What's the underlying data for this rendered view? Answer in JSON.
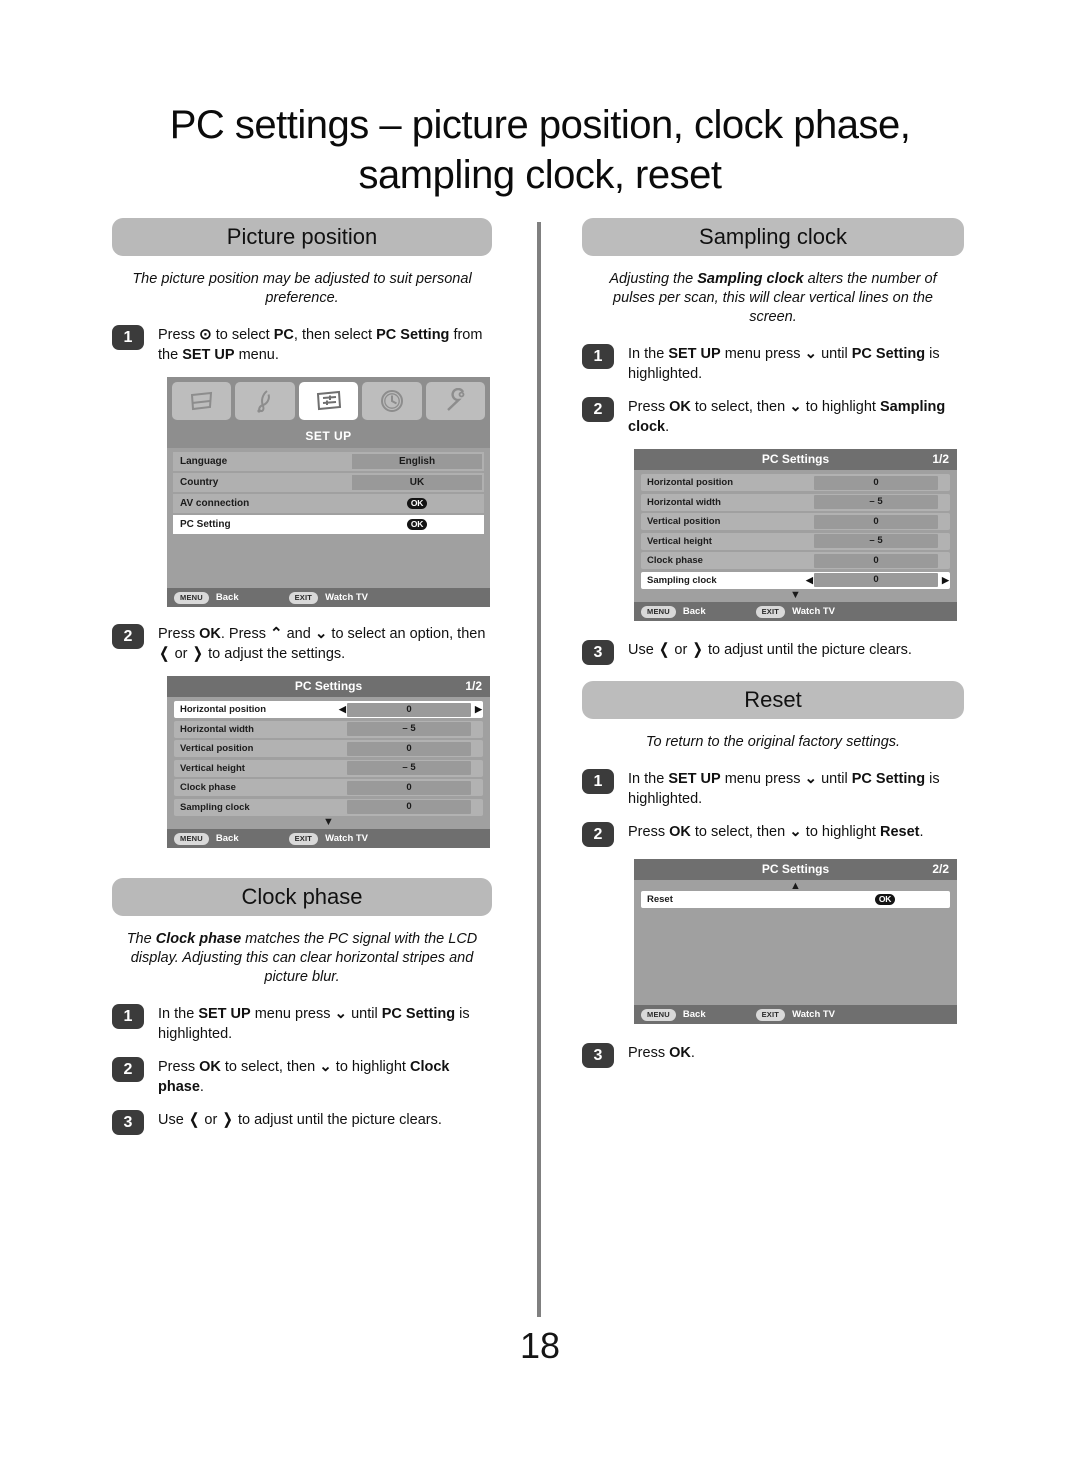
{
  "page": {
    "title_line1": "PC settings – picture position, clock phase,",
    "title_line2": "sampling clock, reset",
    "number": "18"
  },
  "left_column": {
    "picture_position": {
      "header": "Picture position",
      "intro_a": "The picture position may be adjusted to suit personal preference.",
      "steps": [
        {
          "num": "1",
          "t1": "Press ",
          "sym": "⊙",
          "t2": " to select ",
          "b1": "PC",
          "t3": ", then select ",
          "b2": "PC Setting",
          "t4": " from the ",
          "b3": "SET UP",
          "t5": " menu."
        },
        {
          "num": "2",
          "t1": "Press ",
          "b1": "OK",
          "t2": ". Press ",
          "sym1": "⌃",
          "t3": " and ",
          "sym2": "⌄",
          "t4": " to select an option, then ",
          "sym3": "❬",
          "t5": " or ",
          "sym4": "❭",
          "t6": " to adjust the settings."
        }
      ]
    },
    "setup_menu": {
      "title": "SET UP",
      "icons": [
        "picture-icon",
        "sound-icon",
        "setup-sliders-icon",
        "clock-icon",
        "wrench-icon"
      ],
      "active_icon_index": 2,
      "rows": [
        {
          "label": "Language",
          "value": "English",
          "type": "value"
        },
        {
          "label": "Country",
          "value": "UK",
          "type": "value"
        },
        {
          "label": "AV connection",
          "value": "OK",
          "type": "ok"
        },
        {
          "label": "PC Setting",
          "value": "OK",
          "type": "ok",
          "selected": true
        }
      ],
      "footer": {
        "menu_key": "MENU",
        "menu_label": "Back",
        "exit_key": "EXIT",
        "exit_label": "Watch TV"
      }
    },
    "pc_settings_1": {
      "title": "PC Settings",
      "pageno": "1/2",
      "rows": [
        {
          "label": "Horizontal position",
          "value": "0",
          "selected": true
        },
        {
          "label": "Horizontal width",
          "value": "– 5"
        },
        {
          "label": "Vertical position",
          "value": "0"
        },
        {
          "label": "Vertical height",
          "value": "– 5"
        },
        {
          "label": "Clock phase",
          "value": "0"
        },
        {
          "label": "Sampling clock",
          "value": "0"
        }
      ],
      "scroll_indicator": "▼",
      "footer": {
        "menu_key": "MENU",
        "menu_label": "Back",
        "exit_key": "EXIT",
        "exit_label": "Watch TV"
      }
    },
    "clock_phase": {
      "header": "Clock phase",
      "intro_pre": "The ",
      "intro_b": "Clock phase",
      "intro_post": " matches the PC signal with the LCD display. Adjusting this can clear horizontal stripes and picture blur.",
      "steps": [
        {
          "num": "1",
          "t1": "In the ",
          "b1": "SET UP",
          "t2": " menu press ",
          "sym": "⌄",
          "t3": " until ",
          "b2": "PC Setting",
          "t4": " is highlighted."
        },
        {
          "num": "2",
          "t1": "Press ",
          "b1": "OK",
          "t2": " to select, then ",
          "sym": "⌄",
          "t3": " to highlight ",
          "b2": "Clock phase",
          "t4": "."
        },
        {
          "num": "3",
          "t1": "Use ",
          "sym1": "❬",
          "t2": " or ",
          "sym2": "❭",
          "t3": " to adjust until the picture clears."
        }
      ]
    }
  },
  "right_column": {
    "sampling_clock": {
      "header": "Sampling clock",
      "intro_pre": "Adjusting the ",
      "intro_b": "Sampling clock",
      "intro_post": " alters the number of pulses per scan, this will clear vertical lines on the screen.",
      "steps": [
        {
          "num": "1",
          "t1": "In the ",
          "b1": "SET UP",
          "t2": " menu press ",
          "sym": "⌄",
          "t3": " until ",
          "b2": "PC Setting",
          "t4": " is highlighted."
        },
        {
          "num": "2",
          "t1": "Press ",
          "b1": "OK",
          "t2": " to select, then ",
          "sym": "⌄",
          "t3": " to highlight ",
          "b2": "Sampling clock",
          "t4": "."
        }
      ],
      "step3": {
        "num": "3",
        "t1": "Use ",
        "sym1": "❬",
        "t2": " or ",
        "sym2": "❭",
        "t3": " to adjust until the picture clears."
      }
    },
    "pc_settings_1": {
      "title": "PC Settings",
      "pageno": "1/2",
      "rows": [
        {
          "label": "Horizontal position",
          "value": "0"
        },
        {
          "label": "Horizontal width",
          "value": "– 5"
        },
        {
          "label": "Vertical position",
          "value": "0"
        },
        {
          "label": "Vertical height",
          "value": "– 5"
        },
        {
          "label": "Clock phase",
          "value": "0"
        },
        {
          "label": "Sampling clock",
          "value": "0",
          "selected": true
        }
      ],
      "scroll_indicator": "▼",
      "footer": {
        "menu_key": "MENU",
        "menu_label": "Back",
        "exit_key": "EXIT",
        "exit_label": "Watch TV"
      }
    },
    "reset": {
      "header": "Reset",
      "intro": "To return to the original factory settings.",
      "steps": [
        {
          "num": "1",
          "t1": "In the ",
          "b1": "SET UP",
          "t2": " menu press ",
          "sym": "⌄",
          "t3": " until ",
          "b2": "PC Setting",
          "t4": " is highlighted."
        },
        {
          "num": "2",
          "t1": "Press ",
          "b1": "OK",
          "t2": " to select, then ",
          "sym": "⌄",
          "t3": " to highlight ",
          "b2": "Reset",
          "t4": "."
        }
      ],
      "step3": {
        "num": "3",
        "t1": "Press ",
        "b1": "OK",
        "t2": "."
      }
    },
    "pc_settings_2": {
      "title": "PC Settings",
      "pageno": "2/2",
      "scroll_indicator": "▲",
      "rows": [
        {
          "label": "Reset",
          "value": "OK",
          "selected": true
        }
      ],
      "footer": {
        "menu_key": "MENU",
        "menu_label": "Back",
        "exit_key": "EXIT",
        "exit_label": "Watch TV"
      }
    }
  },
  "colors": {
    "pill_gray": "#b9b9b9",
    "badge_dark": "#3b3b3b",
    "osd_header": "#6f6f6f",
    "osd_bg": "#a0a0a0",
    "osd_row": "#b2b2b2",
    "osd_value": "#9a9a9a",
    "selected_row": "#ffffff",
    "divider": "#808080"
  }
}
